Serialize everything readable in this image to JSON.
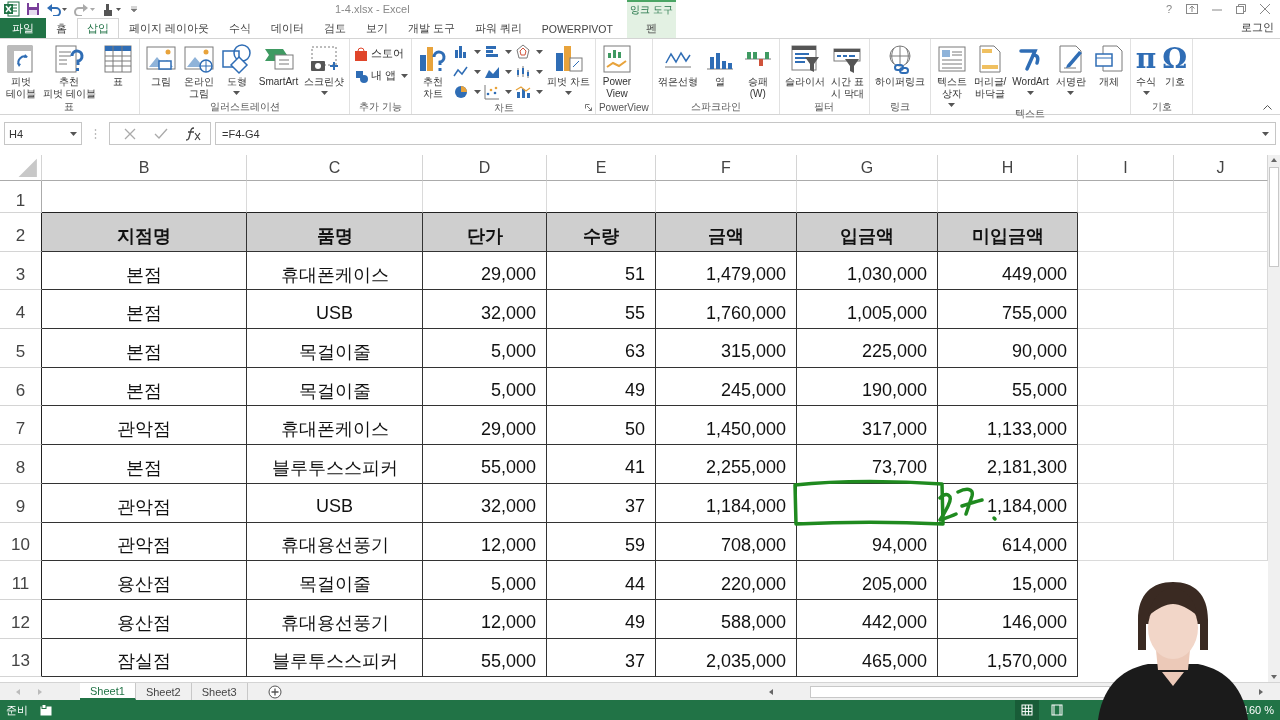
{
  "title_bar": {
    "title": "1-4.xlsx - Excel",
    "help": "?"
  },
  "contextual_tab": {
    "group": "잉크 도구"
  },
  "tabs": [
    {
      "label": "파일",
      "kind": "file",
      "selected": false
    },
    {
      "label": "홈",
      "kind": "normal",
      "selected": false
    },
    {
      "label": "삽입",
      "kind": "normal",
      "selected": true
    },
    {
      "label": "페이지 레이아웃",
      "kind": "normal",
      "selected": false
    },
    {
      "label": "수식",
      "kind": "normal",
      "selected": false
    },
    {
      "label": "데이터",
      "kind": "normal",
      "selected": false
    },
    {
      "label": "검토",
      "kind": "normal",
      "selected": false
    },
    {
      "label": "보기",
      "kind": "normal",
      "selected": false
    },
    {
      "label": "개발 도구",
      "kind": "normal",
      "selected": false
    },
    {
      "label": "파워 쿼리",
      "kind": "normal",
      "selected": false
    },
    {
      "label": "POWERPIVOT",
      "kind": "normal",
      "selected": false
    },
    {
      "label": "펜",
      "kind": "contextual",
      "selected": false
    }
  ],
  "account": "로그인",
  "ribbon": {
    "groups": [
      {
        "label": "표",
        "launcher": false,
        "items": [
          {
            "kind": "large",
            "label": "피벗\n테이블",
            "dropdown": false
          },
          {
            "kind": "large",
            "label": "추천\n피벗 테이블",
            "dropdown": false
          },
          {
            "kind": "large",
            "label": "표",
            "dropdown": false
          }
        ]
      },
      {
        "label": "일러스트레이션",
        "launcher": false,
        "items": [
          {
            "kind": "large",
            "label": "그림",
            "dropdown": false
          },
          {
            "kind": "large",
            "label": "온라인\n그림",
            "dropdown": false
          },
          {
            "kind": "large",
            "label": "도형",
            "dropdown": true
          },
          {
            "kind": "large",
            "label": "SmartArt",
            "dropdown": false
          },
          {
            "kind": "large",
            "label": "스크린샷",
            "dropdown": true
          }
        ]
      },
      {
        "label": "추가 기능",
        "launcher": false,
        "items": [
          {
            "kind": "small",
            "label": "스토어",
            "dropdown": false
          },
          {
            "kind": "small",
            "label": "내 앱",
            "dropdown": true
          }
        ]
      },
      {
        "label": "차트",
        "launcher": true,
        "items": [
          {
            "kind": "large",
            "label": "추천\n차트",
            "dropdown": false
          },
          {
            "kind": "icon",
            "dropdown": true
          },
          {
            "kind": "icon",
            "dropdown": true
          },
          {
            "kind": "icon",
            "dropdown": true
          },
          {
            "kind": "icon",
            "dropdown": true
          },
          {
            "kind": "icon",
            "dropdown": true
          },
          {
            "kind": "icon",
            "dropdown": true
          },
          {
            "kind": "icon",
            "dropdown": true
          },
          {
            "kind": "icon",
            "dropdown": true
          },
          {
            "kind": "icon",
            "dropdown": true
          },
          {
            "kind": "large",
            "label": "피벗 차트",
            "dropdown": true
          }
        ]
      },
      {
        "label": "PowerView",
        "launcher": false,
        "items": [
          {
            "kind": "large",
            "label": "Power\nView",
            "dropdown": false
          }
        ]
      },
      {
        "label": "스파크라인",
        "launcher": false,
        "items": [
          {
            "kind": "large",
            "label": "꺾은선형",
            "dropdown": false
          },
          {
            "kind": "large",
            "label": "열",
            "dropdown": false
          },
          {
            "kind": "large",
            "label": "승패\n(W)",
            "dropdown": false
          }
        ]
      },
      {
        "label": "필터",
        "launcher": false,
        "items": [
          {
            "kind": "large",
            "label": "슬라이서",
            "dropdown": false
          },
          {
            "kind": "large",
            "label": "시간 표\n시 막대",
            "dropdown": false
          }
        ]
      },
      {
        "label": "링크",
        "launcher": false,
        "items": [
          {
            "kind": "large",
            "label": "하이퍼링크",
            "dropdown": false
          }
        ]
      },
      {
        "label": "텍스트",
        "launcher": false,
        "items": [
          {
            "kind": "large",
            "label": "텍스트\n상자",
            "dropdown": true
          },
          {
            "kind": "large",
            "label": "머리글/\n바닥글",
            "dropdown": false
          },
          {
            "kind": "large",
            "label": "WordArt",
            "dropdown": true
          },
          {
            "kind": "large",
            "label": "서명란",
            "dropdown": true
          },
          {
            "kind": "large",
            "label": "개체",
            "dropdown": false
          }
        ]
      },
      {
        "label": "기호",
        "launcher": false,
        "items": [
          {
            "kind": "glyph",
            "glyph": "π",
            "label": "수식",
            "dropdown": true
          },
          {
            "kind": "glyph",
            "glyph": "Ω",
            "label": "기호",
            "dropdown": false
          }
        ]
      }
    ]
  },
  "formula_bar": {
    "name_box": "H4",
    "formula": "=F4-G4"
  },
  "sheet": {
    "column_headers": [
      "B",
      "C",
      "D",
      "E",
      "F",
      "G",
      "H",
      "I",
      "J"
    ],
    "row_headers": [
      "1",
      "2",
      "3",
      "4",
      "5",
      "6",
      "7",
      "8",
      "9",
      "10",
      "11",
      "12",
      "13"
    ],
    "table": {
      "columns": [
        "지점명",
        "품명",
        "단가",
        "수량",
        "금액",
        "입금액",
        "미입금액"
      ],
      "rows": [
        [
          "본점",
          "휴대폰케이스",
          "29,000",
          "51",
          "1,479,000",
          "1,030,000",
          "449,000"
        ],
        [
          "본점",
          "USB",
          "32,000",
          "55",
          "1,760,000",
          "1,005,000",
          "755,000"
        ],
        [
          "본점",
          "목걸이줄",
          "5,000",
          "63",
          "315,000",
          "225,000",
          "90,000"
        ],
        [
          "본점",
          "목걸이줄",
          "5,000",
          "49",
          "245,000",
          "190,000",
          "55,000"
        ],
        [
          "관악점",
          "휴대폰케이스",
          "29,000",
          "50",
          "1,450,000",
          "317,000",
          "1,133,000"
        ],
        [
          "본점",
          "블루투스스피커",
          "55,000",
          "41",
          "2,255,000",
          "73,700",
          "2,181,300"
        ],
        [
          "관악점",
          "USB",
          "32,000",
          "37",
          "1,184,000",
          null,
          "1,184,000"
        ],
        [
          "관악점",
          "휴대용선풍기",
          "12,000",
          "59",
          "708,000",
          "94,000",
          "614,000"
        ],
        [
          "용산점",
          "목걸이줄",
          "5,000",
          "44",
          "220,000",
          "205,000",
          "15,000"
        ],
        [
          "용산점",
          "휴대용선풍기",
          "12,000",
          "49",
          "588,000",
          "442,000",
          "146,000"
        ],
        [
          "잠실점",
          "블루투스스피커",
          "55,000",
          "37",
          "2,035,000",
          "465,000",
          "1,570,000"
        ]
      ]
    }
  },
  "sheet_tabs": [
    {
      "label": "Sheet1",
      "selected": true
    },
    {
      "label": "Sheet2",
      "selected": false
    },
    {
      "label": "Sheet3",
      "selected": false
    }
  ],
  "status_bar": {
    "text": "준비",
    "zoom": "160 %"
  }
}
